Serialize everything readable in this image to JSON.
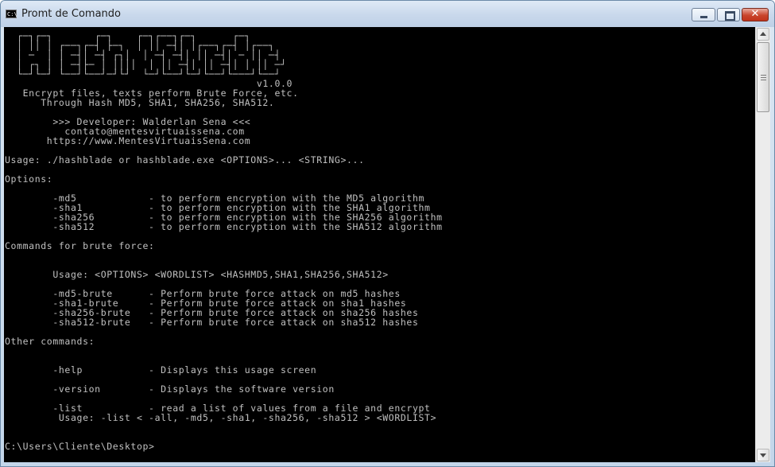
{
  "window": {
    "title": "Promt de Comando",
    "app_icon": "C:\\",
    "close_glyph": "✕"
  },
  "console": {
    "lines": [
      "  ┌─┐┌─┐       ┌─┐    ┌─┐┌──┐┌─┐      ┌─┐",
      "  │ ││ │ ┌──┐┌─┤ ├─┐  │ ││ ─┤│ │┌──┐┌─┤ │┌──┐",
      "  │ ─  │ │ ─┤│ ─┤ ┌┐│  │ ─┤ ─┤│ ││ ─┤│ ─ ││ ─┤",
      "  │ ┌┐ │ │ ─┤├─ │ ││││  │ ││ ─┤│ ││ ─┤│ │ ││ ─┘",
      "  └─┘└─┘ └──┘└──┘─┘└┘  └─┘└──┘└─┘└──┘└───┘└──┘",
      "                                          v1.0.0",
      "   Encrypt files, texts perform Brute Force, etc.",
      "      Through Hash MD5, SHA1, SHA256, SHA512.",
      "",
      "        >>> Developer: Walderlan Sena <<<",
      "          contato@mentesvirtuaissena.com",
      "       https://www.MentesVirtuaisSena.com",
      "",
      "Usage: ./hashblade or hashblade.exe <OPTIONS>... <STRING>...",
      "",
      "Options:",
      "",
      "        -md5            - to perform encryption with the MD5 algorithm",
      "        -sha1           - to perform encryption with the SHA1 algorithm",
      "        -sha256         - to perform encryption with the SHA256 algorithm",
      "        -sha512         - to perform encryption with the SHA512 algorithm",
      "",
      "Commands for brute force:",
      "",
      "",
      "        Usage: <OPTIONS> <WORDLIST> <HASHMD5,SHA1,SHA256,SHA512>",
      "",
      "        -md5-brute      - Perform brute force attack on md5 hashes",
      "        -sha1-brute     - Perform brute force attack on sha1 hashes",
      "        -sha256-brute   - Perform brute force attack on sha256 hashes",
      "        -sha512-brute   - Perform brute force attack on sha512 hashes",
      "",
      "Other commands:",
      "",
      "",
      "        -help           - Displays this usage screen",
      "",
      "        -version        - Displays the software version",
      "",
      "        -list           - read a list of values from a file and encrypt",
      "         Usage: -list < -all, -md5, -sha1, -sha256, -sha512 > <WORDLIST>",
      "",
      "",
      "C:\\Users\\Cliente\\Desktop>"
    ]
  },
  "icons": {
    "app": "cmd-icon",
    "minimize": "minimize-icon",
    "maximize": "maximize-icon",
    "close": "close-icon",
    "scroll_up": "arrow-up-icon",
    "scroll_down": "arrow-down-icon"
  },
  "colors": {
    "console_bg": "#000000",
    "console_fg": "#c0c0c0",
    "close_button": "#c9452c"
  }
}
